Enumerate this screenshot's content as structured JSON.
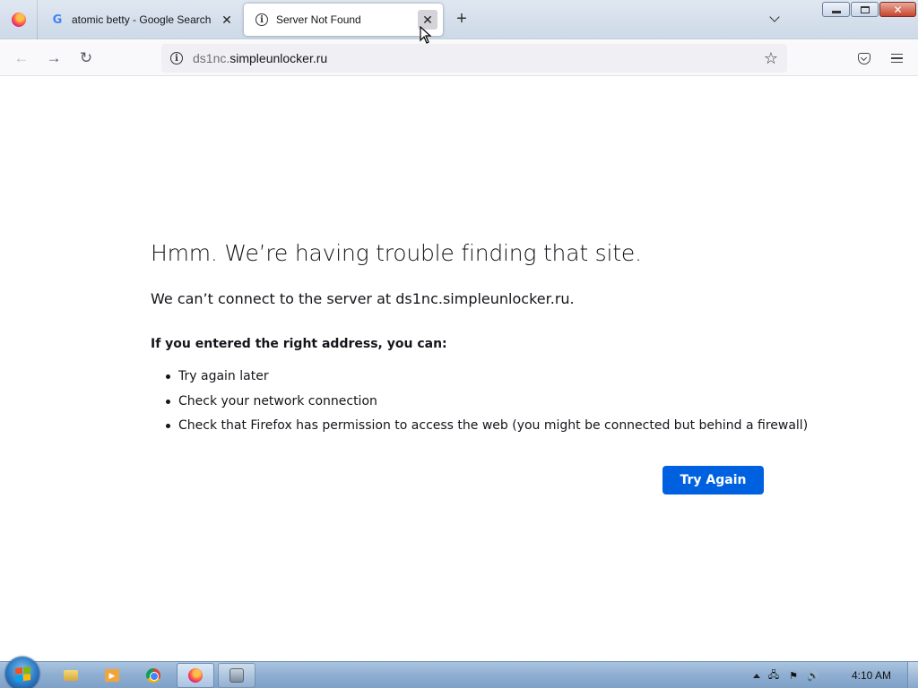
{
  "browser": {
    "tabs": [
      {
        "title": "atomic betty - Google Search",
        "favicon": "google-g-icon",
        "active": false
      },
      {
        "title": "Server Not Found",
        "favicon": "info-icon",
        "active": true
      }
    ],
    "close_glyph": "✕",
    "newtab_glyph": "+",
    "url": {
      "prefix": "ds1nc.",
      "domain": "simpleunlocker.ru"
    },
    "nav_icons": {
      "back": "←",
      "forward": "→",
      "reload": "↻",
      "bookmark": "☆"
    }
  },
  "error_page": {
    "title": "Hmm. We’re having trouble finding that site.",
    "description": "We can’t connect to the server at ds1nc.simpleunlocker.ru.",
    "subtitle": "If you entered the right address, you can:",
    "suggestions": [
      "Try again later",
      "Check your network connection",
      "Check that Firefox has permission to access the web (you might be connected but behind a firewall)"
    ],
    "button_label": "Try Again"
  },
  "taskbar": {
    "items": [
      "windows-explorer-icon",
      "media-player-icon",
      "chrome-icon",
      "firefox-icon",
      "app-icon"
    ],
    "clock": "4:10 AM"
  },
  "colors": {
    "accent": "#0061e0",
    "text": "#15141a"
  }
}
